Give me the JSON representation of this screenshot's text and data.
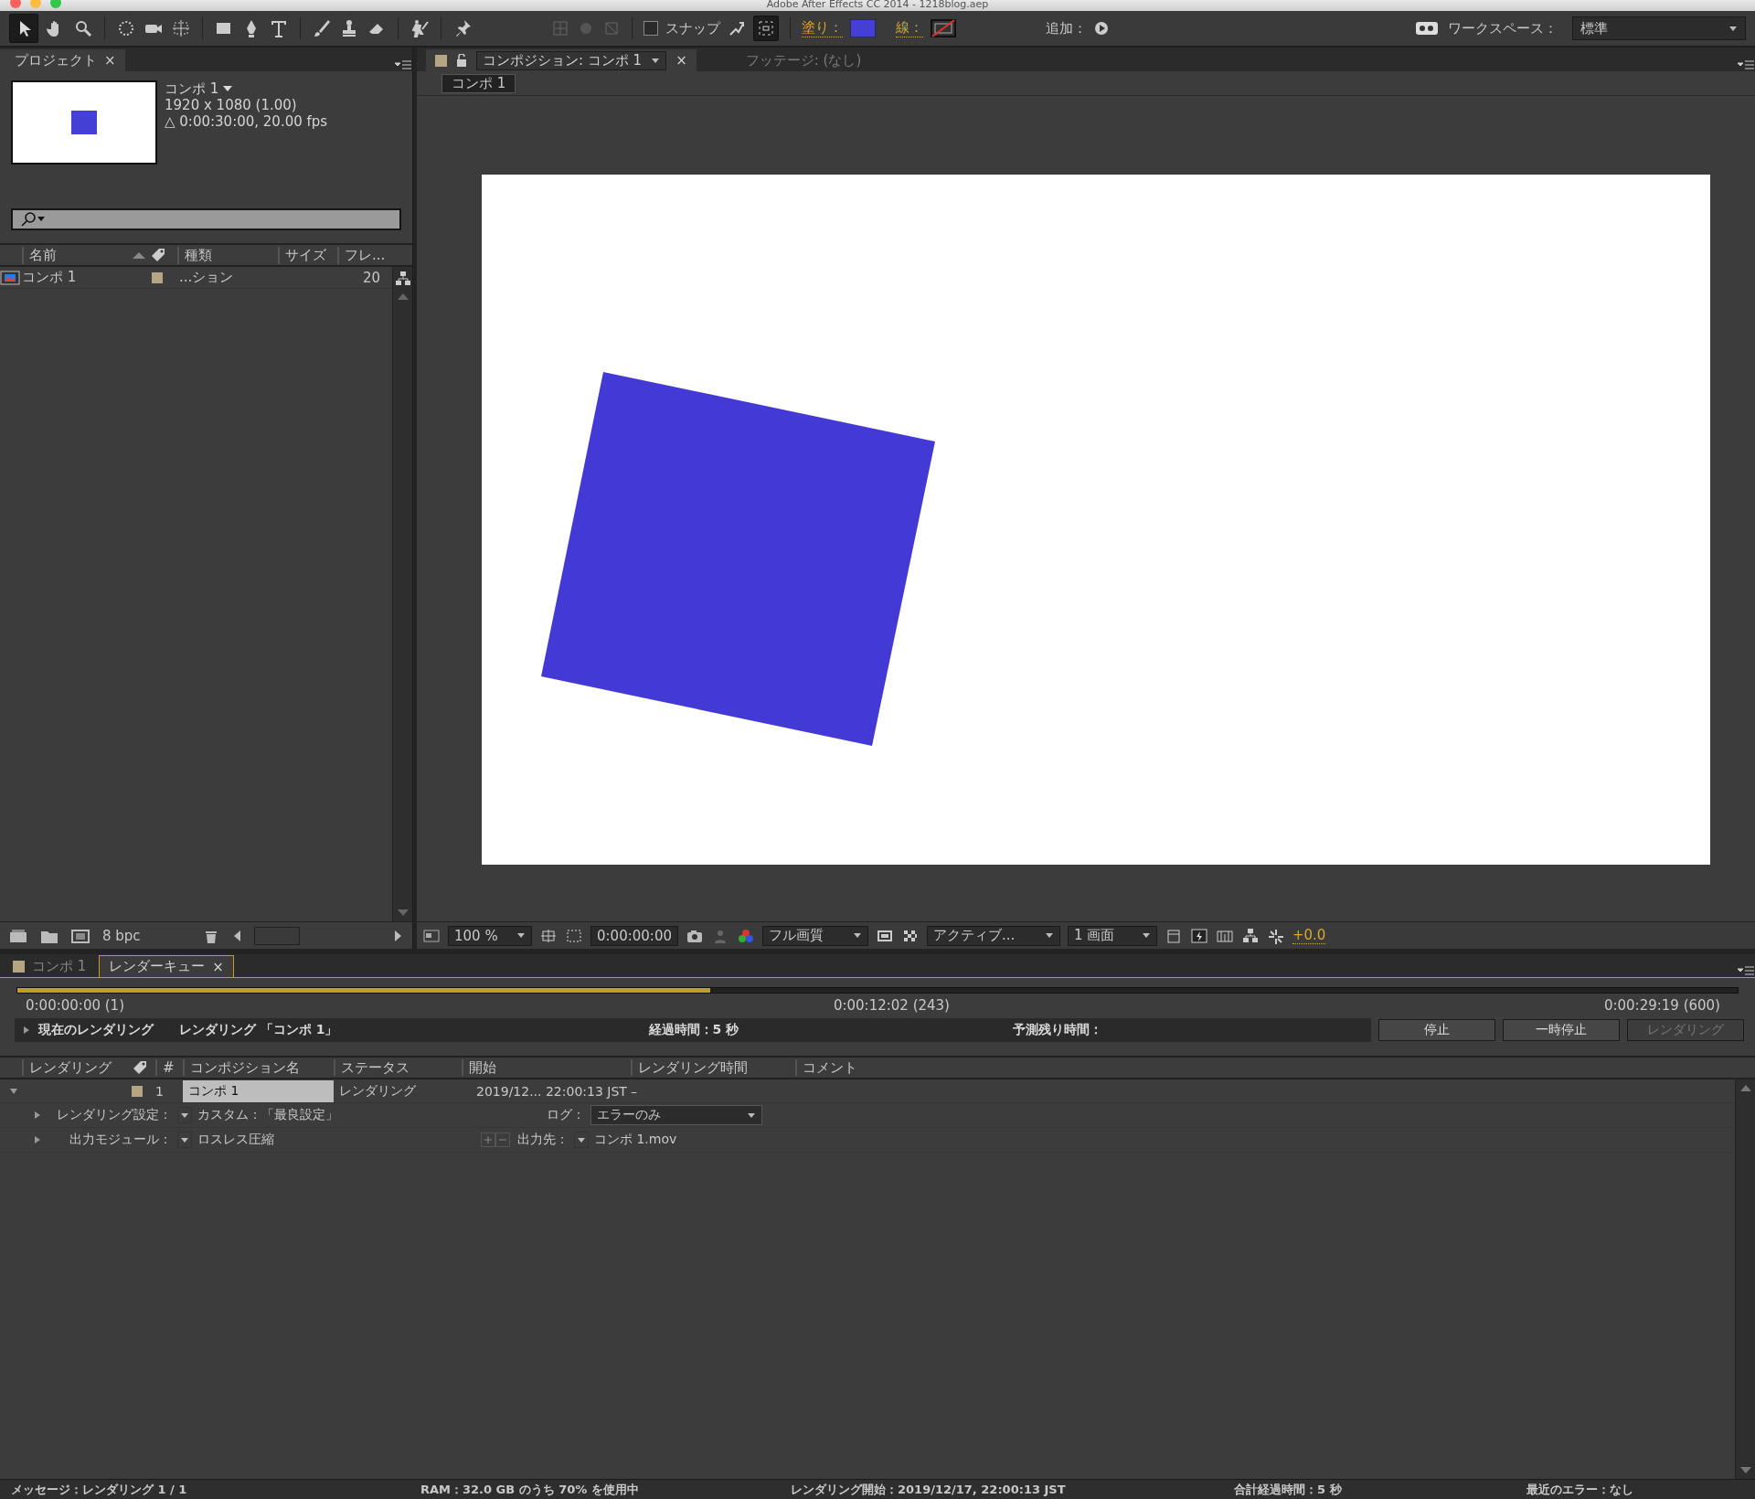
{
  "window": {
    "title": "Adobe After Effects CC 2014 - 1218blog.aep"
  },
  "toolbar": {
    "snap": {
      "label": "スナップ",
      "checked": false
    },
    "fill_label": "塗り：",
    "stroke_label": "線：",
    "add_label": "追加：",
    "workspace_label": "ワークスペース：",
    "workspace_value": "標準"
  },
  "project": {
    "tab": "プロジェクト",
    "close": "×",
    "comp_name": "コンポ 1",
    "dimensions": "1920 x 1080 (1.00)",
    "duration": "△ 0:00:30:00, 20.00 fps",
    "columns": [
      "名前",
      "種類",
      "サイズ",
      "フレ..."
    ],
    "rows": [
      {
        "name": "コンポ 1",
        "color": "#b5a583",
        "type": "...ション",
        "frame_rate": "20"
      }
    ],
    "bpc": "8 bpc"
  },
  "viewer": {
    "tabs": [
      {
        "label": "コンポジション: コンポ 1",
        "selected": true,
        "close": "×"
      },
      {
        "label": "フッテージ: (なし)",
        "selected": false
      }
    ],
    "breadcrumb": "コンポ 1",
    "zoom": "100 %",
    "timecode": "0:00:00:00",
    "resolution": "フル画質",
    "camera": "アクティブ...",
    "views": "1 画面",
    "exposure": "+0.0"
  },
  "render_queue": {
    "tabs": [
      {
        "label": "コンポ 1",
        "selected": false
      },
      {
        "label": "レンダーキュー",
        "selected": true,
        "close": "×"
      }
    ],
    "progress": {
      "level": 0.403
    },
    "start_time": "0:00:00:00 (1)",
    "current_time": "0:00:12:02 (243)",
    "end_time": "0:00:29:19 (600)",
    "current_label": "現在のレンダリング",
    "current_item": "レンダリング 「コンポ 1」",
    "elapsed": "経過時間：5 秒",
    "remaining": "予測残り時間：",
    "buttons": [
      {
        "label": "停止",
        "disabled": false
      },
      {
        "label": "一時停止",
        "disabled": false
      },
      {
        "label": "レンダリング",
        "disabled": true
      }
    ],
    "columns": [
      "レンダリング",
      "#",
      "コンポジション名",
      "ステータス",
      "開始",
      "レンダリング時間",
      "コメント"
    ],
    "items": [
      {
        "number": "1",
        "color": "#b5a583",
        "composition": "コンポ 1",
        "status": "レンダリング",
        "start": "2019/12... 22:00:13 JST",
        "render_time": "–",
        "expanded": true,
        "render_settings_label": "レンダリング設定：",
        "render_settings": "カスタム：「最良設定」",
        "log_label": "ログ：",
        "log": "エラーのみ",
        "output_module_label": "出力モジュール：",
        "output_module": "ロスレス圧縮",
        "output_to_label": "出力先：",
        "output_to": "コンポ 1.mov"
      }
    ]
  },
  "status_bar": [
    "メッセージ：レンダリング 1 / 1",
    "RAM：32.0 GB のうち 70% を使用中",
    "レンダリング開始：2019/12/17, 22:00:13 JST",
    "合計経過時間：5 秒",
    "最近のエラー：なし"
  ]
}
